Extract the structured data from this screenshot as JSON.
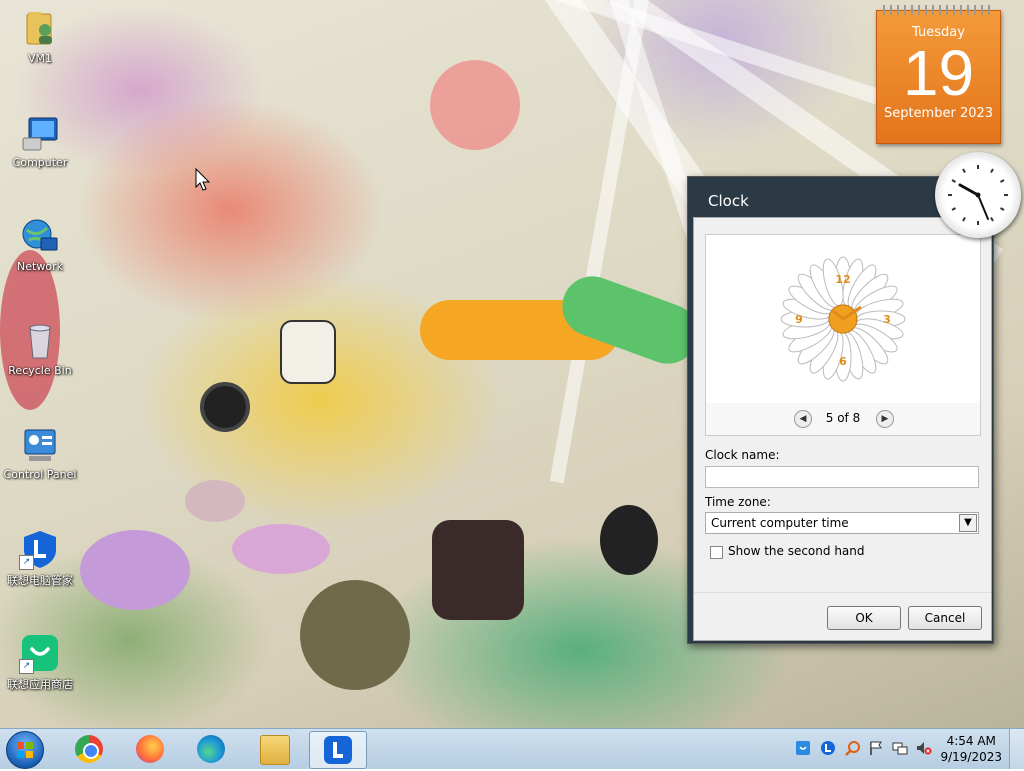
{
  "desktop": {
    "icons": [
      {
        "label": "VM1"
      },
      {
        "label": "Computer"
      },
      {
        "label": "Network"
      },
      {
        "label": "Recycle Bin"
      },
      {
        "label": "Control Panel"
      },
      {
        "label": "联想电脑管家"
      },
      {
        "label": "联想应用商店"
      }
    ]
  },
  "calendar_gadget": {
    "weekday": "Tuesday",
    "day": "19",
    "month_year": "September 2023"
  },
  "clock_dialog": {
    "title": "Clock",
    "pager": {
      "text": "5 of 8",
      "prev_icon": "chevron-left-icon",
      "next_icon": "chevron-right-icon"
    },
    "clock_name_label": "Clock name:",
    "clock_name_value": "",
    "time_zone_label": "Time zone:",
    "time_zone_value": "Current computer time",
    "second_hand_label": "Show the second hand",
    "second_hand_checked": false,
    "ok_label": "OK",
    "cancel_label": "Cancel",
    "preview_numerals": [
      "12",
      "3",
      "6",
      "9"
    ],
    "preview_colors": {
      "petal": "#ffffff",
      "center": "#f0a020",
      "numerals": "#e08a1a"
    }
  },
  "taskbar": {
    "apps": [
      {
        "icon": "chrome-icon"
      },
      {
        "icon": "firefox-icon"
      },
      {
        "icon": "edge-icon"
      },
      {
        "icon": "file-explorer-icon"
      },
      {
        "icon": "lenovo-icon",
        "active": true
      }
    ],
    "tray_icons": [
      "lenovo-shield-icon",
      "lenovo-l-icon",
      "search-magnifier-icon",
      "action-center-flag-icon",
      "network-icon",
      "volume-muted-icon"
    ],
    "time": "4:54 AM",
    "date": "9/19/2023"
  },
  "colors": {
    "calendar_orange": "#ef8a2b",
    "dialog_frame": "#2b3a44",
    "taskbar": "#c3d6e8"
  }
}
